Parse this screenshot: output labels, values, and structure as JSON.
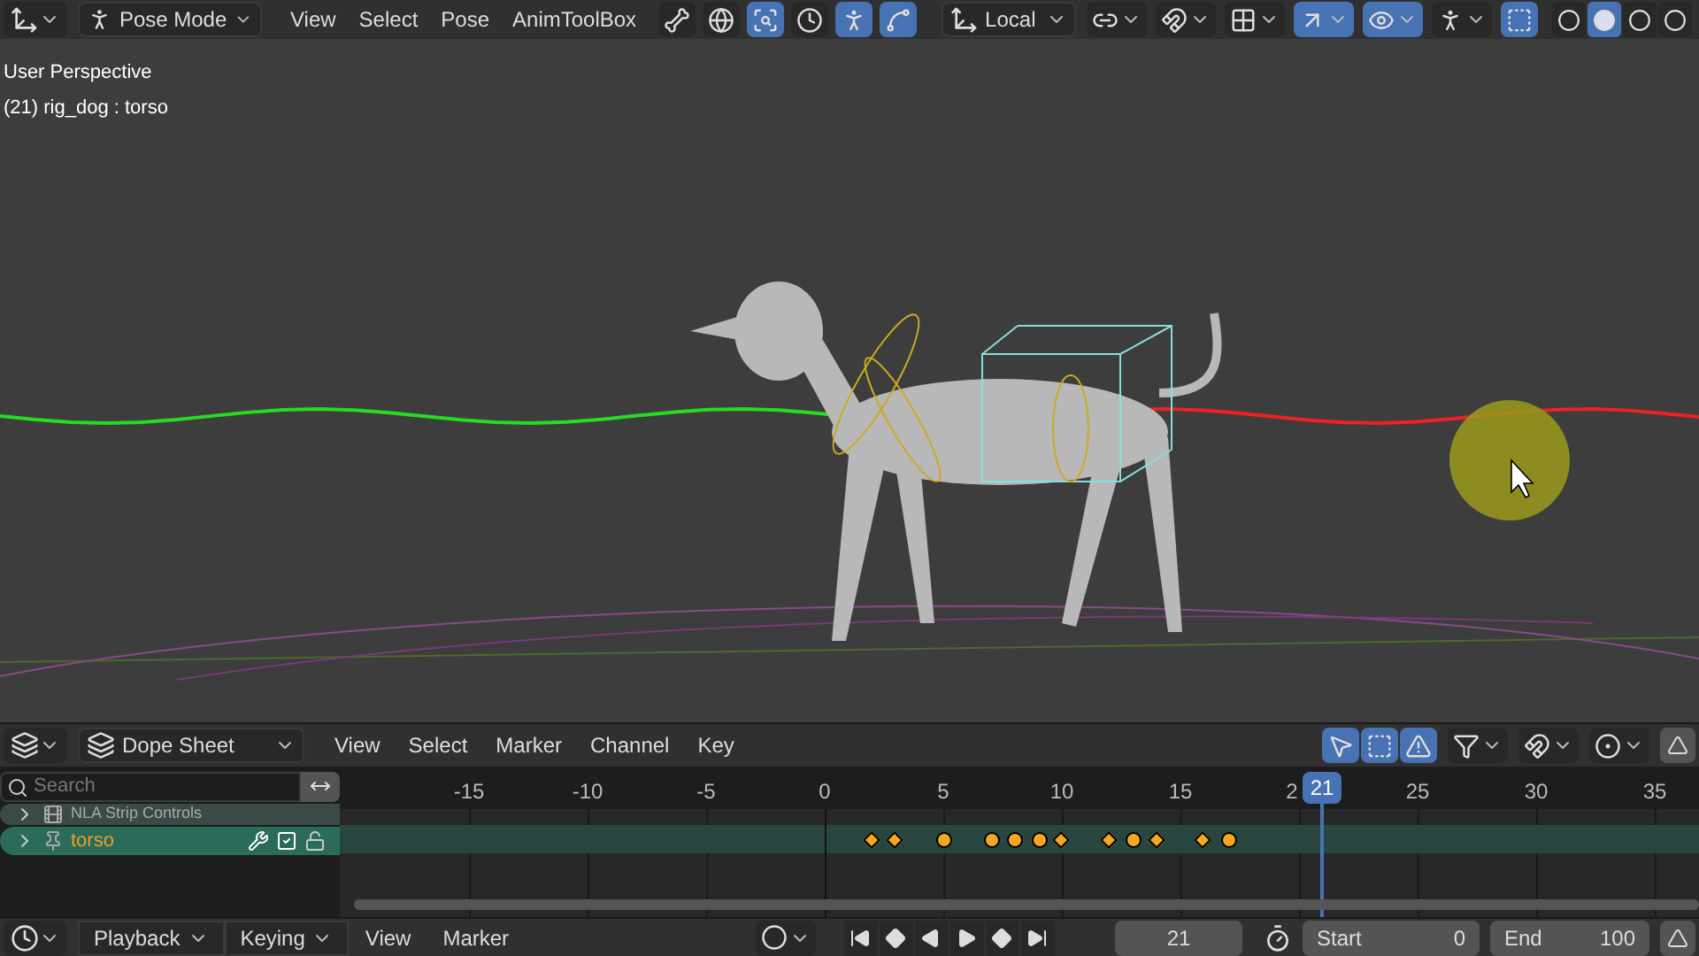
{
  "top_bar": {
    "mode": "Pose Mode",
    "menus": [
      "View",
      "Select",
      "Pose",
      "AnimToolBox"
    ],
    "toggles": [
      {
        "on": false
      },
      {
        "on": false
      },
      {
        "on": true
      },
      {
        "on": false
      },
      {
        "on": true
      },
      {
        "on": true
      }
    ],
    "orientation": "Local",
    "right_toggles": [
      {
        "on": false
      },
      {
        "on": false
      },
      {
        "on": false
      },
      {
        "on": true
      },
      {
        "on": true
      },
      {
        "on": false
      },
      {
        "on": true
      }
    ],
    "shading": [
      {
        "selected": false
      },
      {
        "selected": true
      },
      {
        "selected": false
      },
      {
        "selected": false
      }
    ]
  },
  "viewport": {
    "lines": [
      "User Perspective",
      "(21) rig_dog : torso"
    ]
  },
  "dope_sheet": {
    "editor": "Dope Sheet",
    "menus": [
      "View",
      "Select",
      "Marker",
      "Channel",
      "Key"
    ],
    "tools": [
      {
        "on": true
      },
      {
        "on": true
      },
      {
        "on": true
      }
    ],
    "search": {
      "placeholder": "Search"
    },
    "channels": [
      {
        "name": "NLA Strip Controls",
        "selected": false
      },
      {
        "name": "torso",
        "selected": true
      }
    ],
    "ruler": [
      "-15",
      "-10",
      "-5",
      "0",
      "5",
      "10",
      "15",
      "2",
      "25",
      "30",
      "35"
    ],
    "current_frame": "21",
    "track": [
      {
        "kind": "none"
      },
      {
        "kind": "none"
      },
      {
        "kind": "diamond"
      },
      {
        "kind": "diamond"
      },
      {
        "kind": "none"
      },
      {
        "kind": "circle"
      },
      {
        "kind": "none"
      },
      {
        "kind": "circle"
      },
      {
        "kind": "circle"
      },
      {
        "kind": "circle"
      },
      {
        "kind": "diamond"
      },
      {
        "kind": "none"
      },
      {
        "kind": "diamond"
      },
      {
        "kind": "circle"
      },
      {
        "kind": "diamond"
      },
      {
        "kind": "none"
      },
      {
        "kind": "diamond"
      },
      {
        "kind": "circle"
      }
    ]
  },
  "timeline": {
    "menus": [
      {
        "label": "Playback",
        "kind": "dropdown"
      },
      {
        "label": "Keying",
        "kind": "dropdown"
      },
      {
        "label": "View",
        "kind": "plain"
      },
      {
        "label": "Marker",
        "kind": "plain"
      }
    ],
    "frame": "21",
    "start_label": "Start",
    "start": "0",
    "end_label": "End",
    "end": "100"
  }
}
